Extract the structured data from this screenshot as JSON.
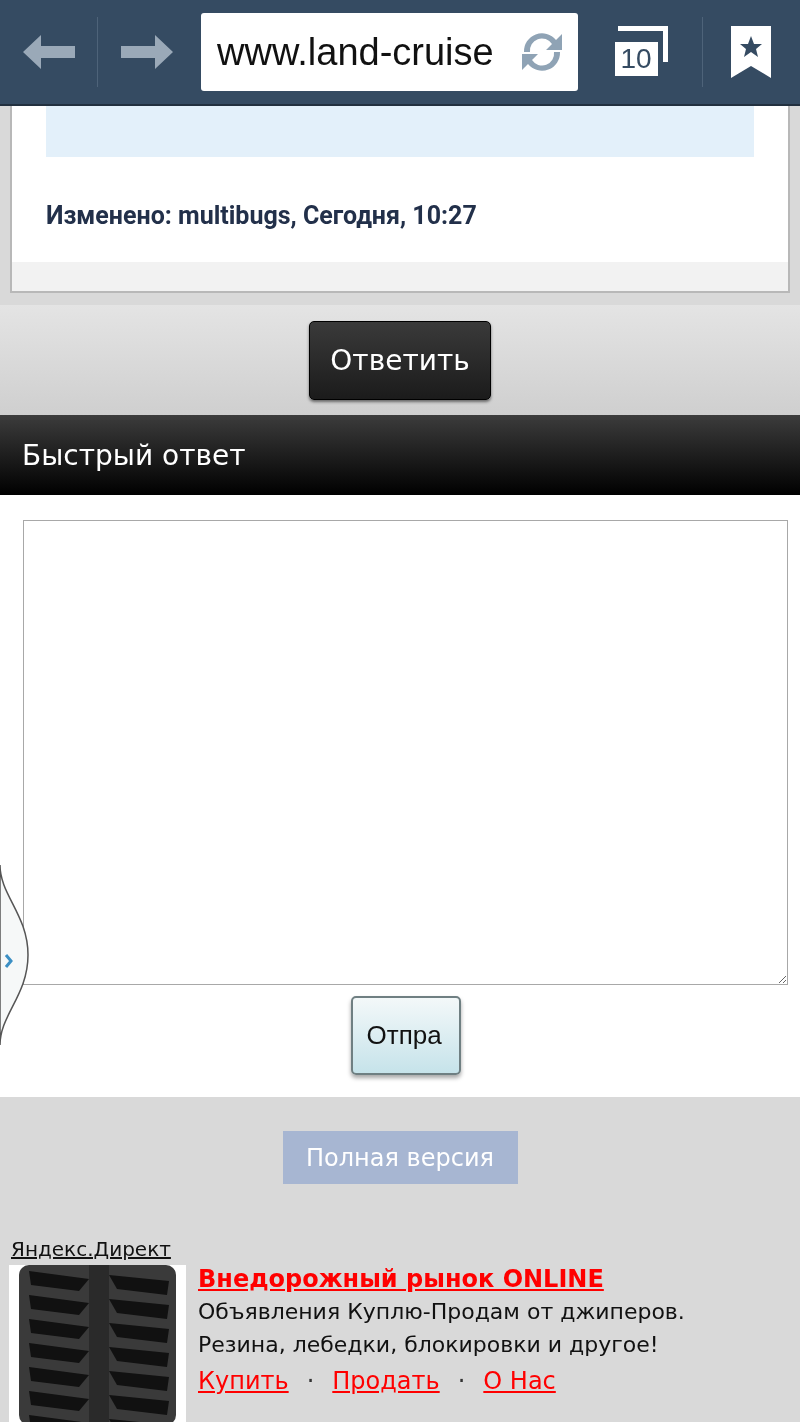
{
  "toolbar": {
    "url": "www.land-cruise",
    "tab_count": "10"
  },
  "post": {
    "edited": "Изменено: multibugs, Сегодня, 10:27"
  },
  "reply_button": "Ответить",
  "quick_reply": {
    "title": "Быстрый ответ",
    "send_button": "Отпра"
  },
  "full_version": "Полная версия",
  "ad": {
    "source": "Яндекс.Директ",
    "title": "Внедорожный рынок ONLINE",
    "description": "Объявления Куплю-Продам от джиперов.\nРезина, лебедки, блокировки и другое!",
    "links": [
      "Купить",
      "Продать",
      "О Нас"
    ],
    "separators": [
      "·",
      "·"
    ]
  }
}
